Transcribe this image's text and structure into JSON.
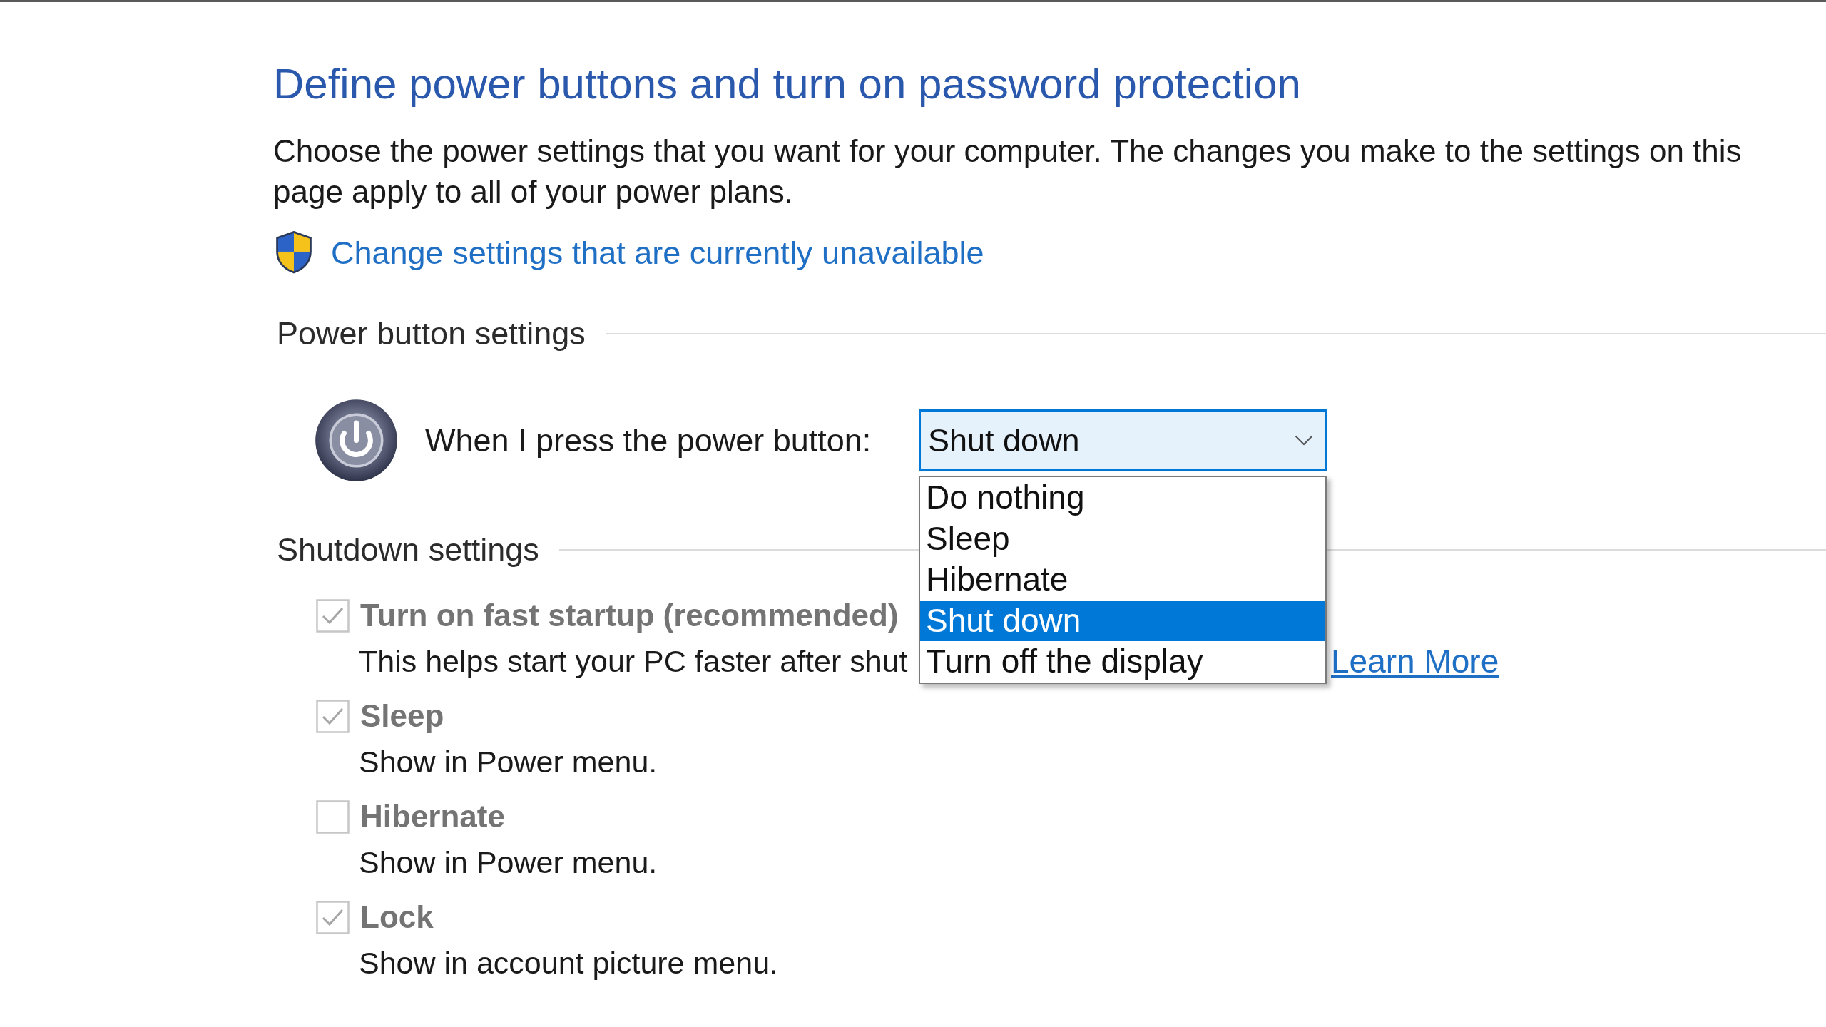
{
  "page": {
    "title": "Define power buttons and turn on password protection",
    "description": "Choose the power settings that you want for your computer. The changes you make to the settings on this page apply to all of your power plans.",
    "admin_link": "Change settings that are currently unavailable"
  },
  "power_button_settings": {
    "heading": "Power button settings",
    "label": "When I press the power button:",
    "dropdown": {
      "value": "Shut down",
      "expanded": true,
      "options": [
        {
          "label": "Do nothing",
          "selected": false
        },
        {
          "label": "Sleep",
          "selected": false
        },
        {
          "label": "Hibernate",
          "selected": false
        },
        {
          "label": "Shut down",
          "selected": true
        },
        {
          "label": "Turn off the display",
          "selected": false
        }
      ]
    }
  },
  "shutdown_settings": {
    "heading": "Shutdown settings",
    "options": [
      {
        "label": "Turn on fast startup (recommended)",
        "checked": true,
        "disabled": true,
        "description": "This helps start your PC faster after shut",
        "link": "Learn More"
      },
      {
        "label": "Sleep",
        "checked": true,
        "disabled": true,
        "description": "Show in Power menu."
      },
      {
        "label": "Hibernate",
        "checked": false,
        "disabled": true,
        "description": "Show in Power menu."
      },
      {
        "label": "Lock",
        "checked": true,
        "disabled": true,
        "description": "Show in account picture menu."
      }
    ]
  }
}
